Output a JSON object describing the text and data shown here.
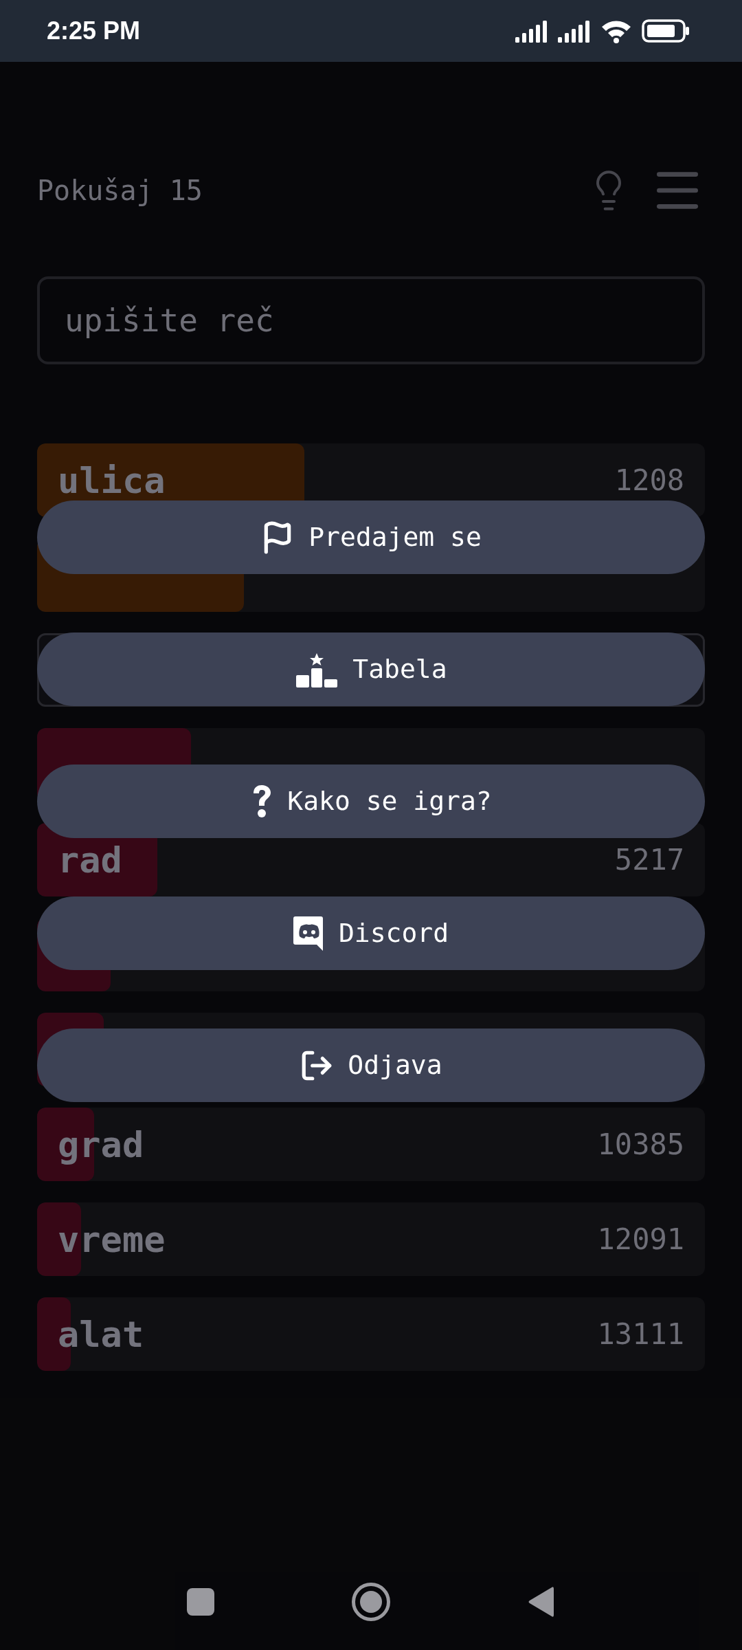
{
  "status_bar": {
    "time": "2:25 PM"
  },
  "header": {
    "title": "Pokušaj 15"
  },
  "search": {
    "placeholder": "upišite reč"
  },
  "rows": [
    {
      "kind": "guess",
      "word": "ulica",
      "rank": "1208",
      "level": 0.4,
      "color": "#3a1d06"
    },
    {
      "kind": "guess",
      "level": 0.31,
      "color": "#3a1d06"
    },
    {
      "kind": "current"
    },
    {
      "kind": "guess",
      "level": 0.23,
      "color": "#3a0818"
    },
    {
      "kind": "guess",
      "word": "rad",
      "rank": "5217",
      "level": 0.18,
      "color": "#3a0818"
    },
    {
      "kind": "guess",
      "level": 0.11,
      "color": "#3a0818"
    },
    {
      "kind": "guess",
      "level": 0.1,
      "color": "#3a0818"
    },
    {
      "kind": "guess",
      "word": "grad",
      "rank": "10385",
      "level": 0.085,
      "color": "#3a0818"
    },
    {
      "kind": "guess",
      "word": "vreme",
      "rank": "12091",
      "level": 0.066,
      "color": "#3a0818"
    },
    {
      "kind": "guess",
      "word": "alat",
      "rank": "13111",
      "level": 0.05,
      "color": "#3a0818"
    }
  ],
  "menu": [
    {
      "label": "Predajem se"
    },
    {
      "label": "Tabela"
    },
    {
      "label": "Kako se igra?"
    },
    {
      "label": "Discord"
    },
    {
      "label": "Odjava"
    }
  ]
}
